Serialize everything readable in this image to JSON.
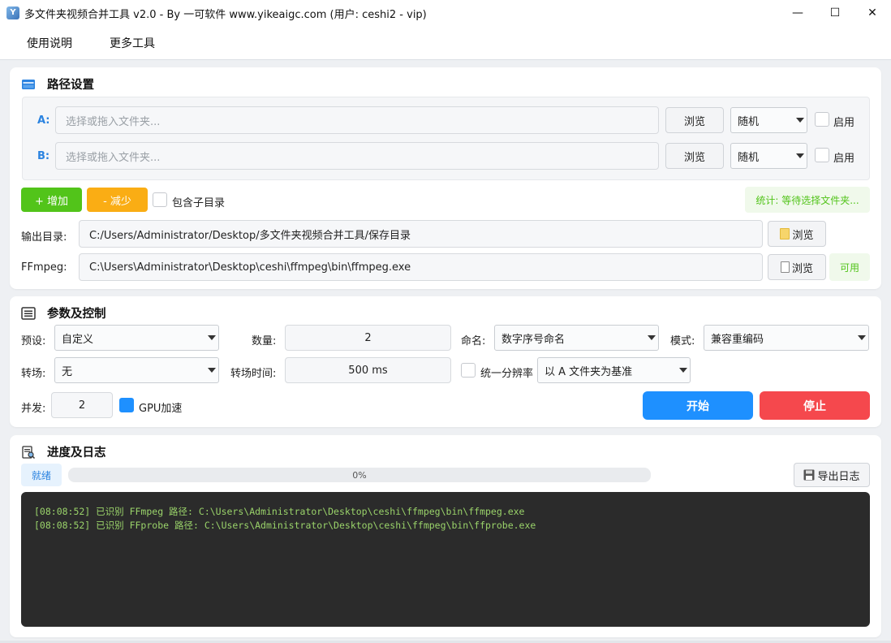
{
  "window": {
    "title": "多文件夹视频合并工具 v2.0 - By 一可软件 www.yikeaigc.com (用户: ceshi2 - vip)",
    "app_icon_text": "Y",
    "minimize_glyph": "—",
    "maximize_glyph": "☐",
    "close_glyph": "✕"
  },
  "menu": {
    "items": [
      "使用说明",
      "更多工具"
    ]
  },
  "path_section": {
    "title": "路径设置",
    "rows": [
      {
        "label": "A:",
        "placeholder": "选择或拖入文件夹...",
        "browse": "浏览",
        "order": "随机",
        "enable": "启用",
        "enabled": false
      },
      {
        "label": "B:",
        "placeholder": "选择或拖入文件夹...",
        "browse": "浏览",
        "order": "随机",
        "enable": "启用",
        "enabled": false
      }
    ],
    "add_button": "+  增加",
    "remove_button": "-  减少",
    "include_subdirs": "包含子目录",
    "include_subdirs_checked": false,
    "stats": "统计: 等待选择文件夹...",
    "output_label": "输出目录:",
    "output_value": "C:/Users/Administrator/Desktop/多文件夹视频合并工具/保存目录",
    "output_browse": "浏览",
    "ffmpeg_label": "FFmpeg:",
    "ffmpeg_value": "C:\\Users\\Administrator\\Desktop\\ceshi\\ffmpeg\\bin\\ffmpeg.exe",
    "ffmpeg_browse": "浏览",
    "ffmpeg_status": "可用"
  },
  "params_section": {
    "title": "参数及控制",
    "preset_label": "预设:",
    "preset_value": "自定义",
    "count_label": "数量:",
    "count_value": "2",
    "naming_label": "命名:",
    "naming_value": "数字序号命名",
    "mode_label": "模式:",
    "mode_value": "兼容重编码",
    "transition_label": "转场:",
    "transition_value": "无",
    "transition_time_label": "转场时间:",
    "transition_time_value": "500 ms",
    "unify_resolution": "统一分辨率",
    "unify_checked": false,
    "resolution_base": "以 A 文件夹为基准",
    "concurrency_label": "并发:",
    "concurrency_value": "2",
    "gpu_label": "GPU加速",
    "gpu_checked": true,
    "start_button": "开始",
    "stop_button": "停止"
  },
  "log_section": {
    "title": "进度及日志",
    "status": "就绪",
    "progress_percent": 0,
    "progress_text": "0%",
    "export_button": "导出日志",
    "lines": [
      "[08:08:52] 已识别 FFmpeg 路径: C:\\Users\\Administrator\\Desktop\\ceshi\\ffmpeg\\bin\\ffmpeg.exe",
      "[08:08:52] 已识别 FFprobe 路径: C:\\Users\\Administrator\\Desktop\\ceshi\\ffmpeg\\bin\\ffprobe.exe"
    ]
  },
  "colors": {
    "accent": "#1e90ff",
    "success": "#52c41a",
    "warning": "#faad14",
    "danger": "#f5484d",
    "log_bg": "#2b2b2b",
    "log_text": "#9ad36a"
  }
}
